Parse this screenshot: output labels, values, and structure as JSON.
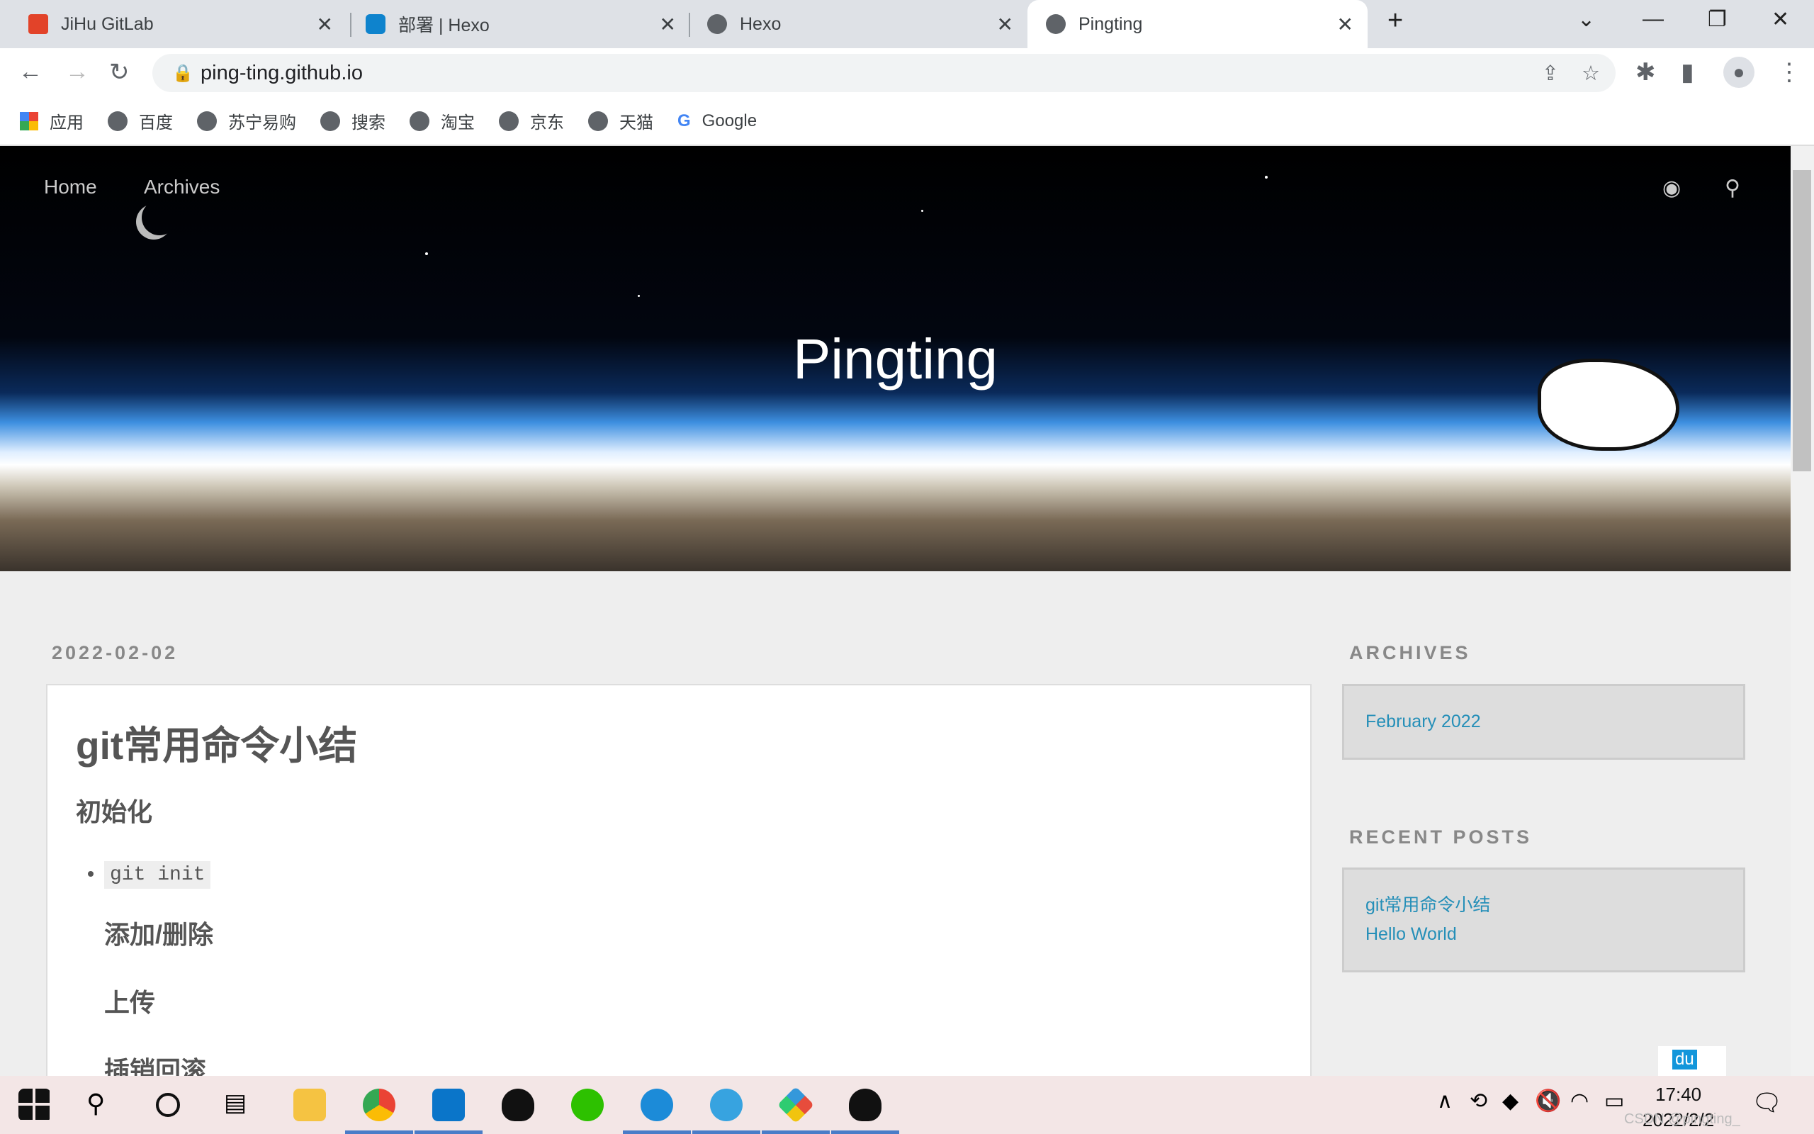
{
  "browser": {
    "tabs": [
      {
        "title": "JiHu GitLab"
      },
      {
        "title": "部署 | Hexo"
      },
      {
        "title": "Hexo"
      },
      {
        "title": "Pingting",
        "active": true
      }
    ],
    "url": "ping-ting.github.io",
    "bookmarks": [
      "应用",
      "百度",
      "苏宁易购",
      "搜索",
      "淘宝",
      "京东",
      "天猫",
      "Google"
    ]
  },
  "site": {
    "nav": [
      "Home",
      "Archives"
    ],
    "title": "Pingting",
    "post": {
      "date": "2022-02-02",
      "title": "git常用命令小结",
      "h2": "初始化",
      "list": [
        "git init"
      ],
      "h3": [
        "添加/删除",
        "上传",
        "插销回滚"
      ]
    },
    "sidebar": {
      "archives_title": "ARCHIVES",
      "archives": [
        "February 2022"
      ],
      "recent_title": "RECENT POSTS",
      "recent": [
        "git常用命令小结",
        "Hello World"
      ]
    }
  },
  "taskbar": {
    "time": "17:40",
    "date": "2022/2/2",
    "watermark": "CSDN @pingting_"
  },
  "colors": {
    "link": "#258fb8",
    "accent": "#4a7cc8"
  }
}
